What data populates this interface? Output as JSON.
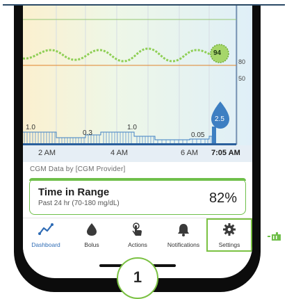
{
  "chart_data": {
    "type": "line",
    "glucose": {
      "current_value": "94",
      "y_labels": [
        "80",
        "50"
      ]
    },
    "insulin": {
      "labels": [
        "1.0",
        "0.3",
        "1.0",
        "0.05"
      ],
      "bolus_value": "2.5"
    },
    "x_labels": [
      "2 AM",
      "4 AM",
      "6 AM",
      "7:05 AM"
    ]
  },
  "provider": "CGM Data by [CGM Provider]",
  "time_in_range": {
    "title": "Time in Range",
    "subtitle": "Past 24 hr (70-180 mg/dL)",
    "value": "82%"
  },
  "nav": [
    {
      "label": "Dashboard",
      "icon": "dashboard-icon"
    },
    {
      "label": "Bolus",
      "icon": "drop-icon"
    },
    {
      "label": "Actions",
      "icon": "tap-hand-icon"
    },
    {
      "label": "Notifications",
      "icon": "bell-icon"
    },
    {
      "label": "Settings",
      "icon": "gear-icon"
    }
  ],
  "step_number": "1",
  "colors": {
    "accent_green": "#7ac142",
    "nav_active": "#2f6cb5",
    "insulin_blue": "#3d7fc2",
    "glucose_green": "#8fcf56"
  }
}
